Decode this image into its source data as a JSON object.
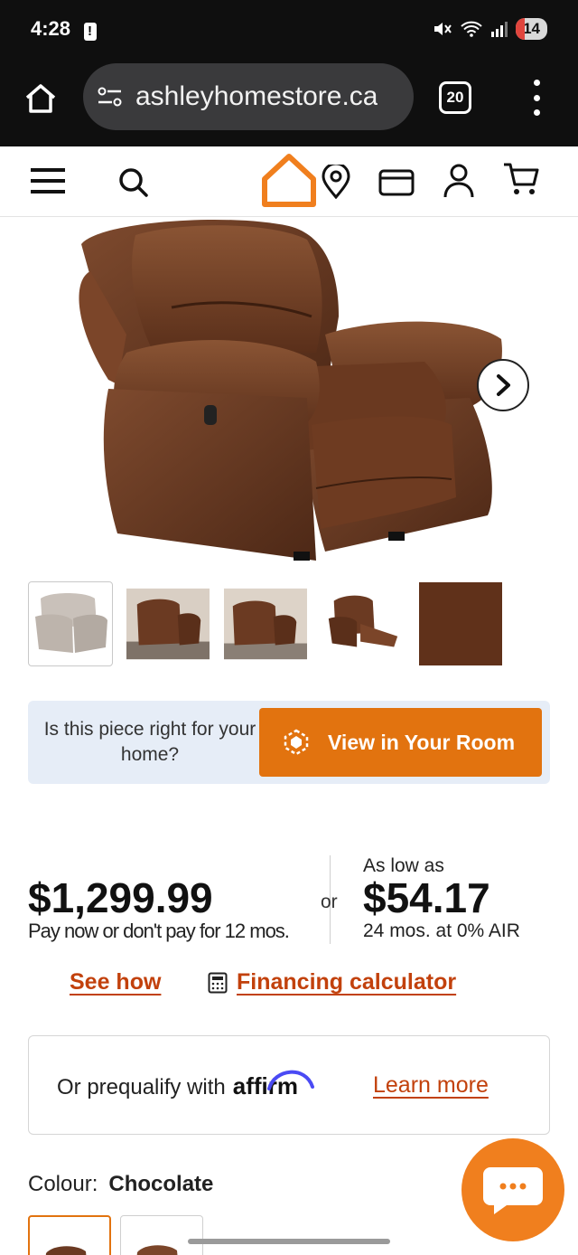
{
  "status_bar": {
    "time": "4:28",
    "battery": "14"
  },
  "browser": {
    "url": "ashleyhomestore.ca",
    "tab_count": "20"
  },
  "site_header": {
    "icons": [
      "menu-icon",
      "search-icon",
      "ashley-home-logo",
      "location-icon",
      "card-icon",
      "account-icon",
      "cart-icon"
    ]
  },
  "product": {
    "colors": {
      "leather": "#6b3a22",
      "leather_dark": "#4a2614",
      "accent": "#e2730f",
      "link": "#c2410c"
    }
  },
  "view_in_room": {
    "question": "Is this piece right for your home?",
    "button_label": "View in Your Room"
  },
  "pricing": {
    "price": "$1,299.99",
    "pay_now": "Pay now or don't pay for 12 mos.",
    "or": "or",
    "as_low_as": "As low as",
    "monthly": "$54.17",
    "terms": "24 mos. at 0% AIR",
    "see_how": "See how",
    "financing_calculator": "Financing calculator"
  },
  "affirm": {
    "prefix": "Or prequalify with",
    "logo": "affirm",
    "learn_more": "Learn more"
  },
  "colour": {
    "label": "Colour:",
    "value": "Chocolate"
  }
}
